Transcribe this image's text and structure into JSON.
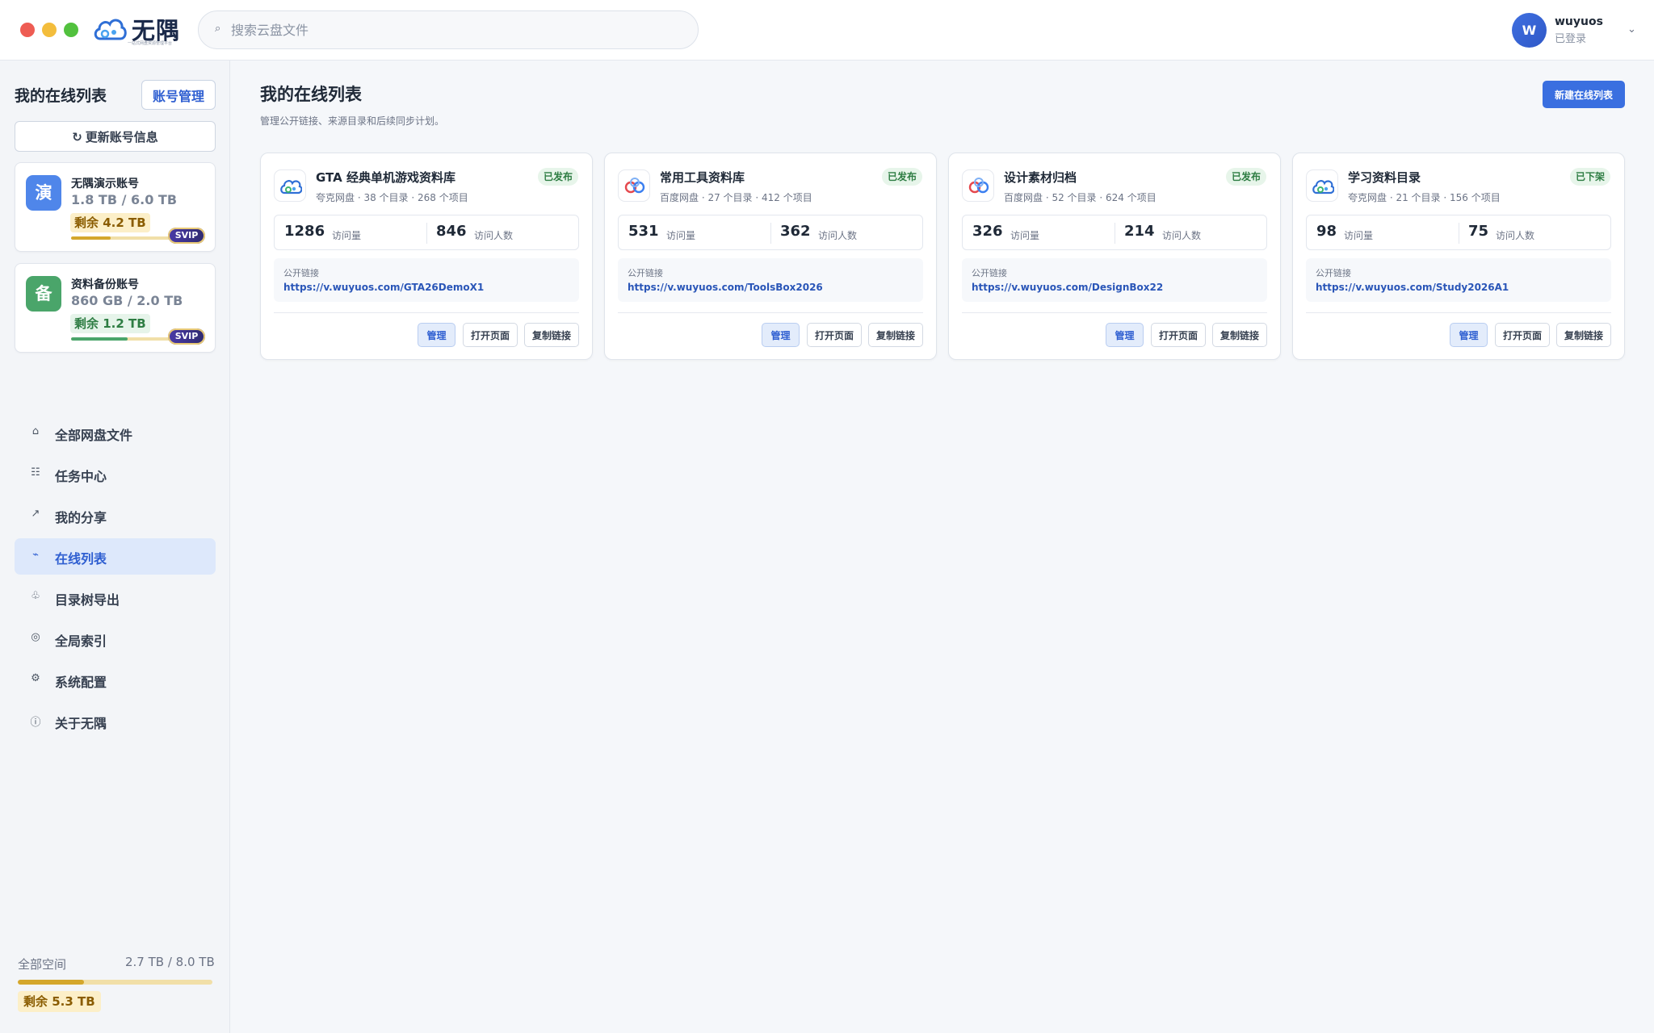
{
  "app": {
    "logo_text": "无隅",
    "logo_subtitle": "一站式网盘资源管理平台"
  },
  "search": {
    "placeholder": "搜索云盘文件",
    "value": ""
  },
  "user": {
    "avatar_letter": "W",
    "name": "wuyuos",
    "status": "已登录"
  },
  "sidebar": {
    "title": "我的在线列表",
    "account_button": "账号管理",
    "refresh_button": "更新账号信息",
    "accounts": [
      {
        "avatar": "演",
        "avatar_color": "#4f86ea",
        "name": "无隅演示账号",
        "usage": "1.8 TB / 6.0 TB",
        "remaining": "剩余 4.2 TB",
        "remain_bg": "#fcefc8",
        "remain_color": "#8a5c00",
        "bar_fraction": 0.3,
        "bar_color": "#d4a72c",
        "badge": "SVIP"
      },
      {
        "avatar": "备",
        "avatar_color": "#4aa56a",
        "name": "资料备份账号",
        "usage": "860 GB / 2.0 TB",
        "remaining": "剩余 1.2 TB",
        "remain_bg": "#e6f4ea",
        "remain_color": "#2e7d43",
        "bar_fraction": 0.43,
        "bar_color": "#4aa56a",
        "badge": "SVIP"
      }
    ],
    "nav": [
      {
        "icon": "home-icon",
        "glyph": "⌂",
        "label": "全部网盘文件",
        "active": false
      },
      {
        "icon": "task-list-icon",
        "glyph": "☷",
        "label": "任务中心",
        "active": false
      },
      {
        "icon": "share-arrow-icon",
        "glyph": "↗",
        "label": "我的分享",
        "active": false
      },
      {
        "icon": "online-list-icon",
        "glyph": "⌁",
        "label": "在线列表",
        "active": true
      },
      {
        "icon": "tree-export-icon",
        "glyph": "♧",
        "label": "目录树导出",
        "active": false
      },
      {
        "icon": "index-icon",
        "glyph": "◎",
        "label": "全局索引",
        "active": false
      },
      {
        "icon": "gear-icon",
        "glyph": "⚙",
        "label": "系统配置",
        "active": false
      },
      {
        "icon": "info-icon",
        "glyph": "ⓘ",
        "label": "关于无隅",
        "active": false
      }
    ],
    "total": {
      "label": "全部空间",
      "value": "2.7 TB / 8.0 TB",
      "remaining": "剩余 5.3 TB",
      "bar_fraction": 0.34
    }
  },
  "main": {
    "title": "我的在线列表",
    "subtitle": "管理公开链接、来源目录和后续同步计划。",
    "new_button": "新建在线列表",
    "visits_label": "访问量",
    "visitors_label": "访问人数",
    "link_label": "公开链接",
    "buttons": {
      "manage": "管理",
      "open": "打开页面",
      "copy": "复制链接"
    },
    "cards": [
      {
        "name": "GTA 经典单机游戏资料库",
        "provider": "quark",
        "meta": "夸克网盘 · 38 个目录 · 268 个项目",
        "status": "已发布",
        "visits": "1286",
        "visitors": "846",
        "url": "https://v.wuyuos.com/GTA26DemoX1"
      },
      {
        "name": "常用工具资料库",
        "provider": "baidu",
        "meta": "百度网盘 · 27 个目录 · 412 个项目",
        "status": "已发布",
        "visits": "531",
        "visitors": "362",
        "url": "https://v.wuyuos.com/ToolsBox2026"
      },
      {
        "name": "设计素材归档",
        "provider": "baidu",
        "meta": "百度网盘 · 52 个目录 · 624 个项目",
        "status": "已发布",
        "visits": "326",
        "visitors": "214",
        "url": "https://v.wuyuos.com/DesignBox22"
      },
      {
        "name": "学习资料目录",
        "provider": "quark",
        "meta": "夸克网盘 · 21 个目录 · 156 个项目",
        "status": "已下架",
        "visits": "98",
        "visitors": "75",
        "url": "https://v.wuyuos.com/Study2026A1"
      }
    ]
  },
  "colors": {
    "accent": "#3a6fe0",
    "success": "#2e7d43",
    "warning": "#d4a72c"
  }
}
